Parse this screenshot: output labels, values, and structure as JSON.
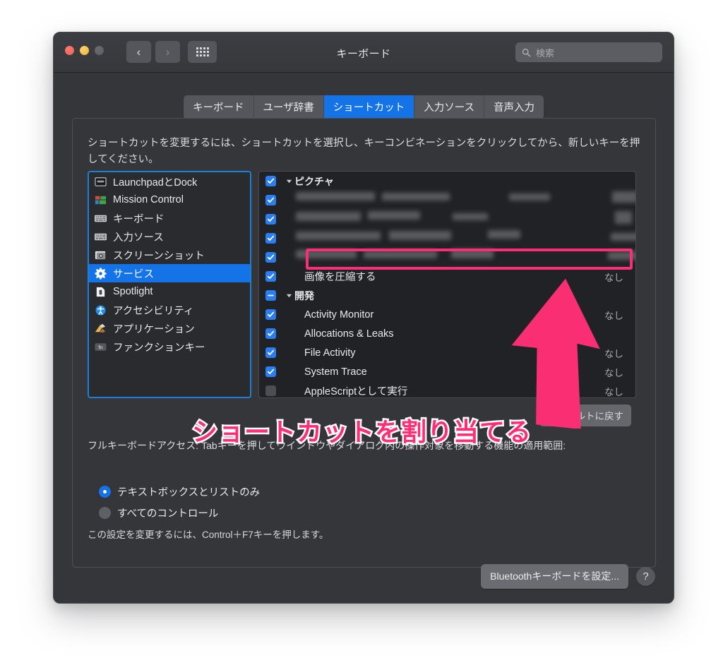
{
  "window": {
    "title": "キーボード",
    "traffic_lights": [
      "close",
      "minimize",
      "zoom"
    ],
    "nav_back": "‹",
    "nav_forward": "›",
    "search_placeholder": "検索",
    "search_value": ""
  },
  "tabs": [
    {
      "label": "キーボード",
      "active": false
    },
    {
      "label": "ユーザ辞書",
      "active": false
    },
    {
      "label": "ショートカット",
      "active": true
    },
    {
      "label": "入力ソース",
      "active": false
    },
    {
      "label": "音声入力",
      "active": false
    }
  ],
  "hint": "ショートカットを変更するには、ショートカットを選択し、キーコンビネーションをクリックしてから、新しいキーを押してください。",
  "sidebar": {
    "items": [
      {
        "label": "LaunchpadとDock",
        "icon": "launchpad-dock-icon",
        "selected": false
      },
      {
        "label": "Mission Control",
        "icon": "mission-control-icon",
        "selected": false
      },
      {
        "label": "キーボード",
        "icon": "keyboard-icon",
        "selected": false
      },
      {
        "label": "入力ソース",
        "icon": "input-source-icon",
        "selected": false
      },
      {
        "label": "スクリーンショット",
        "icon": "screenshot-icon",
        "selected": false
      },
      {
        "label": "サービス",
        "icon": "services-gear-icon",
        "selected": true
      },
      {
        "label": "Spotlight",
        "icon": "spotlight-icon",
        "selected": false
      },
      {
        "label": "アクセシビリティ",
        "icon": "accessibility-icon",
        "selected": false
      },
      {
        "label": "アプリケーション",
        "icon": "applications-icon",
        "selected": false
      },
      {
        "label": "ファンクションキー",
        "icon": "fn-key-icon",
        "selected": false
      }
    ]
  },
  "shortcut_list": {
    "rows": [
      {
        "kind": "group",
        "label": "ピクチャ",
        "checkbox": "on",
        "shortcut": "",
        "blurred": false,
        "highlighted": false
      },
      {
        "kind": "item",
        "label": "",
        "checkbox": "on",
        "shortcut": "",
        "blurred": true,
        "highlighted": false
      },
      {
        "kind": "item",
        "label": "",
        "checkbox": "on",
        "shortcut": "",
        "blurred": true,
        "highlighted": false
      },
      {
        "kind": "item",
        "label": "",
        "checkbox": "on",
        "shortcut": "",
        "blurred": true,
        "highlighted": false
      },
      {
        "kind": "item",
        "label": "",
        "checkbox": "on",
        "shortcut": "",
        "blurred": true,
        "highlighted": false
      },
      {
        "kind": "item",
        "label": "画像を圧縮する",
        "checkbox": "on",
        "shortcut": "なし",
        "blurred": false,
        "highlighted": true
      },
      {
        "kind": "group",
        "label": "開発",
        "checkbox": "mixed",
        "shortcut": "",
        "blurred": false,
        "highlighted": false
      },
      {
        "kind": "item",
        "label": "Activity Monitor",
        "checkbox": "on",
        "shortcut": "なし",
        "blurred": false,
        "highlighted": false
      },
      {
        "kind": "item",
        "label": "Allocations & Leaks",
        "checkbox": "on",
        "shortcut": "",
        "blurred": false,
        "highlighted": false
      },
      {
        "kind": "item",
        "label": "File Activity",
        "checkbox": "on",
        "shortcut": "なし",
        "blurred": false,
        "highlighted": false
      },
      {
        "kind": "item",
        "label": "System Trace",
        "checkbox": "on",
        "shortcut": "なし",
        "blurred": false,
        "highlighted": false
      },
      {
        "kind": "item",
        "label": "AppleScriptとして実行",
        "checkbox": "off",
        "shortcut": "なし",
        "blurred": false,
        "highlighted": false
      }
    ]
  },
  "restore_defaults_label": "デフォルトに戻す",
  "full_keyboard_access": {
    "description": "フルキーボードアクセス: Tabキーを押してウインドウやダイアログ内の操作対象を移動する機能の適用範囲:",
    "options": [
      {
        "label": "テキストボックスとリストのみ",
        "selected": true
      },
      {
        "label": "すべてのコントロール",
        "selected": false
      }
    ],
    "note": "この設定を変更するには、Control＋F7キーを押します。"
  },
  "footer": {
    "bluetooth_label": "Bluetoothキーボードを設定...",
    "help_label": "?"
  },
  "annotation": {
    "text": "ショートカットを割り当てる",
    "color": "#ff2d74",
    "outline": "#ffffff"
  },
  "colors": {
    "accent_blue": "#1473e6",
    "checkbox_blue": "#2a7ef0",
    "annotation_pink": "#fa2e72",
    "window_bg": "#35363a",
    "list_bg": "#212225"
  }
}
